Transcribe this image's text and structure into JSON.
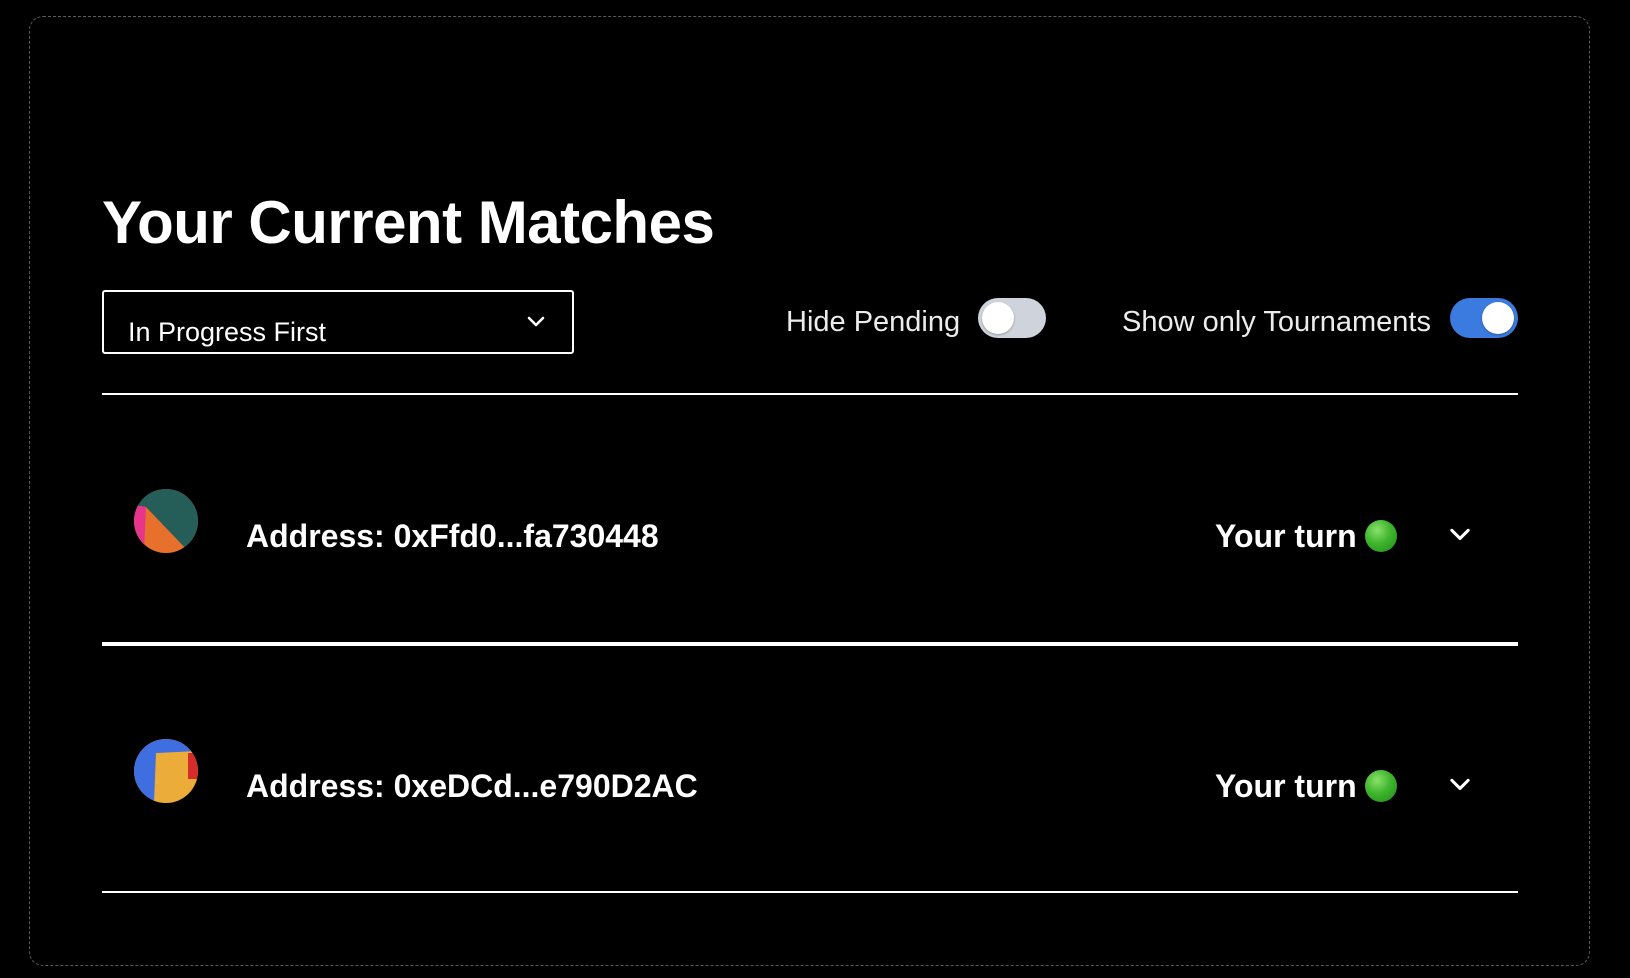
{
  "page": {
    "title": "Your Current Matches"
  },
  "filters": {
    "sort": {
      "selected": "In Progress First",
      "icon": "chevron-down-icon"
    },
    "hide_pending": {
      "label": "Hide Pending",
      "on": false
    },
    "show_only_tournaments": {
      "label": "Show only Tournaments",
      "on": true
    }
  },
  "matches": [
    {
      "address": "Address: 0xFfd0...fa730448",
      "status": "Your turn",
      "status_icon": "green-circle-icon",
      "avatar_icon": "identicon-avatar",
      "expand_icon": "chevron-down-icon"
    },
    {
      "address": "Address: 0xeDCd...e790D2AC",
      "status": "Your turn",
      "status_icon": "green-circle-icon",
      "avatar_icon": "identicon-avatar",
      "expand_icon": "chevron-down-icon"
    }
  ],
  "colors": {
    "background": "#000000",
    "toggle_on": "#3b7bdf",
    "toggle_off": "#cfd4dc",
    "status_green": "#3fb62e"
  }
}
